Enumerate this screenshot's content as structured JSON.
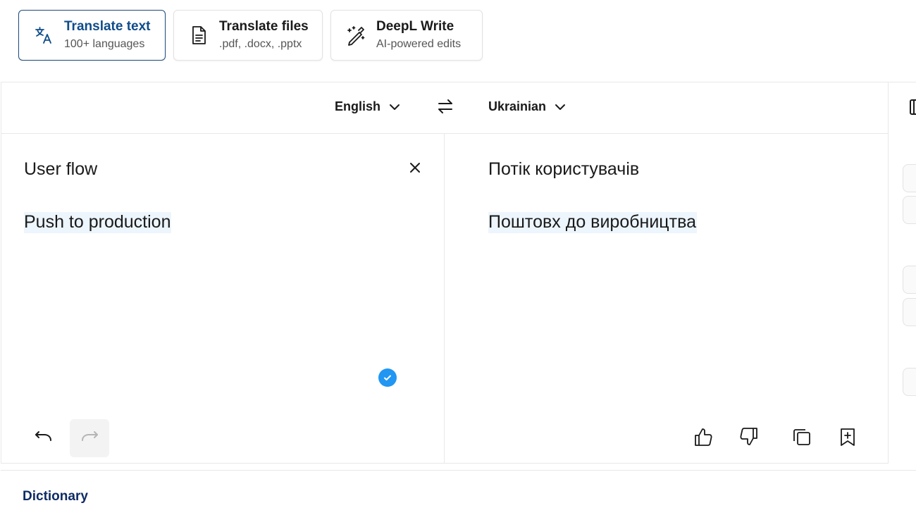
{
  "modes": [
    {
      "title": "Translate text",
      "subtitle": "100+ languages",
      "icon": "translate-icon",
      "active": true
    },
    {
      "title": "Translate files",
      "subtitle": ".pdf, .docx, .pptx",
      "icon": "document-icon",
      "active": false
    },
    {
      "title": "DeepL Write",
      "subtitle": "AI-powered edits",
      "icon": "magic-pen-icon",
      "active": false
    }
  ],
  "languages": {
    "source": "English",
    "target": "Ukrainian"
  },
  "source": {
    "line1": "User flow",
    "line2": "Push to production"
  },
  "target": {
    "line1": "Потік користувачів",
    "line2": "Поштовх до виробництва"
  },
  "dictionary": {
    "label": "Dictionary"
  },
  "colors": {
    "accent": "#0f4c8a",
    "check": "#2196f3",
    "highlight": "#edf5fd"
  }
}
